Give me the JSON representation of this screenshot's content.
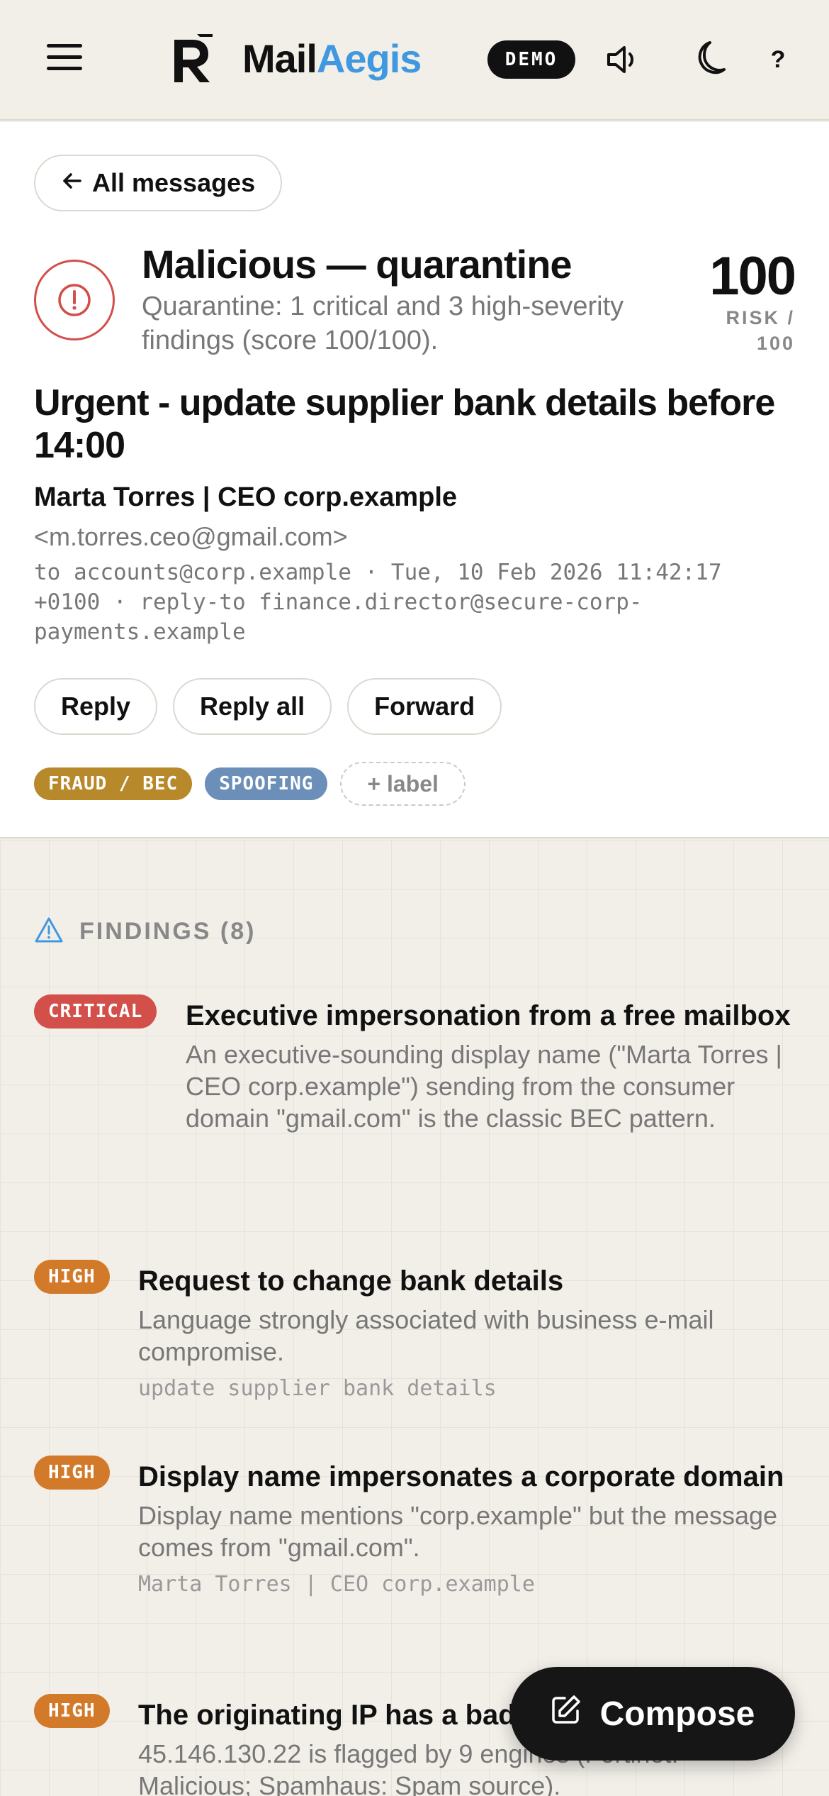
{
  "topbar": {
    "brand_part1": "Mail",
    "brand_part2": "Aegis",
    "demo_badge": "DEMO",
    "help_label": "?",
    "icons": [
      "menu-icon",
      "logo-mark",
      "speaker-icon",
      "moon-icon",
      "help-icon"
    ]
  },
  "message": {
    "back_label": "All messages",
    "verdict_title": "Malicious — quarantine",
    "verdict_summary": "Quarantine: 1 critical and 3 high-severity findings (score 100/100).",
    "risk_score": "100",
    "risk_label": "RISK / 100",
    "subject": "Urgent - update supplier bank details before 14:00",
    "sender_name": "Marta Torres | CEO corp.example",
    "sender_email": "<m.torres.ceo@gmail.com>",
    "meta": "to accounts@corp.example · Tue, 10 Feb 2026 11:42:17 +0100 · reply-to finance.director@secure-corp-payments.example",
    "actions": {
      "reply": "Reply",
      "reply_all": "Reply all",
      "forward": "Forward"
    },
    "labels": [
      {
        "text": "FRAUD / BEC",
        "color": "#b8892a"
      },
      {
        "text": "SPOOFING",
        "color": "#6b8fb8"
      }
    ],
    "add_label": "+ label"
  },
  "findings": {
    "heading": "FINDINGS (8)",
    "items": [
      {
        "severity": "CRITICAL",
        "title": "Executive impersonation from a free mailbox",
        "description": "An executive-sounding display name (\"Marta Torres | CEO corp.example\") sending from the consumer domain \"gmail.com\" is the classic BEC pattern.",
        "evidence": ""
      },
      {
        "severity": "HIGH",
        "title": "Request to change bank details",
        "description": "Language strongly associated with business e-mail compromise.",
        "evidence": "update supplier bank details"
      },
      {
        "severity": "HIGH",
        "title": "Display name impersonates a corporate domain",
        "description": "Display name mentions \"corp.example\" but the message comes from \"gmail.com\".",
        "evidence": "Marta Torres | CEO corp.example"
      },
      {
        "severity": "HIGH",
        "title": "The originating IP has a bad reputation",
        "description": "45.146.130.22 is flagged by 9 engines (Fortinet: Malicious; Spamhaus: Spam source).",
        "evidence": ""
      }
    ]
  },
  "compose_label": "Compose",
  "colors": {
    "accent": "#3f98e0",
    "critical": "#d34f4a",
    "high": "#d37a2a",
    "background": "#f2efe9"
  }
}
